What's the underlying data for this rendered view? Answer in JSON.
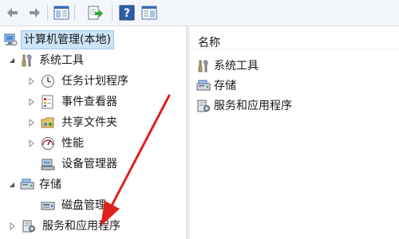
{
  "toolbar": {
    "buttons": [
      {
        "name": "back-button",
        "icon": "back-arrow-icon"
      },
      {
        "name": "forward-button",
        "icon": "forward-arrow-icon"
      },
      {
        "name": "show-hide-console-tree-button",
        "icon": "console-tree-icon"
      },
      {
        "name": "export-list-button",
        "icon": "export-icon"
      },
      {
        "name": "help-button",
        "icon": "help-icon"
      },
      {
        "name": "show-hide-action-pane-button",
        "icon": "action-pane-icon"
      }
    ]
  },
  "tree": {
    "root": {
      "label": "计算机管理(本地)",
      "icon": "computer-management-icon"
    },
    "items": [
      {
        "label": "系统工具",
        "icon": "tools-icon",
        "expanded": true
      },
      {
        "label": "任务计划程序",
        "icon": "clock-icon"
      },
      {
        "label": "事件查看器",
        "icon": "event-viewer-icon"
      },
      {
        "label": "共享文件夹",
        "icon": "shared-folder-icon"
      },
      {
        "label": "性能",
        "icon": "performance-icon"
      },
      {
        "label": "设备管理器",
        "icon": "device-manager-icon"
      },
      {
        "label": "存储",
        "icon": "storage-icon",
        "expanded": true
      },
      {
        "label": "磁盘管理",
        "icon": "disk-icon"
      },
      {
        "label": "服务和应用程序",
        "icon": "services-apps-icon"
      }
    ]
  },
  "list": {
    "header": "名称",
    "items": [
      {
        "label": "系统工具",
        "icon": "tools-icon"
      },
      {
        "label": "存储",
        "icon": "storage-icon"
      },
      {
        "label": "服务和应用程序",
        "icon": "services-apps-icon"
      }
    ]
  },
  "colors": {
    "selection": "#cce4f7",
    "selection_border": "#99c9ef",
    "annotation_arrow": "#e0201b",
    "toolbar_bg": "#f3f6fb"
  }
}
